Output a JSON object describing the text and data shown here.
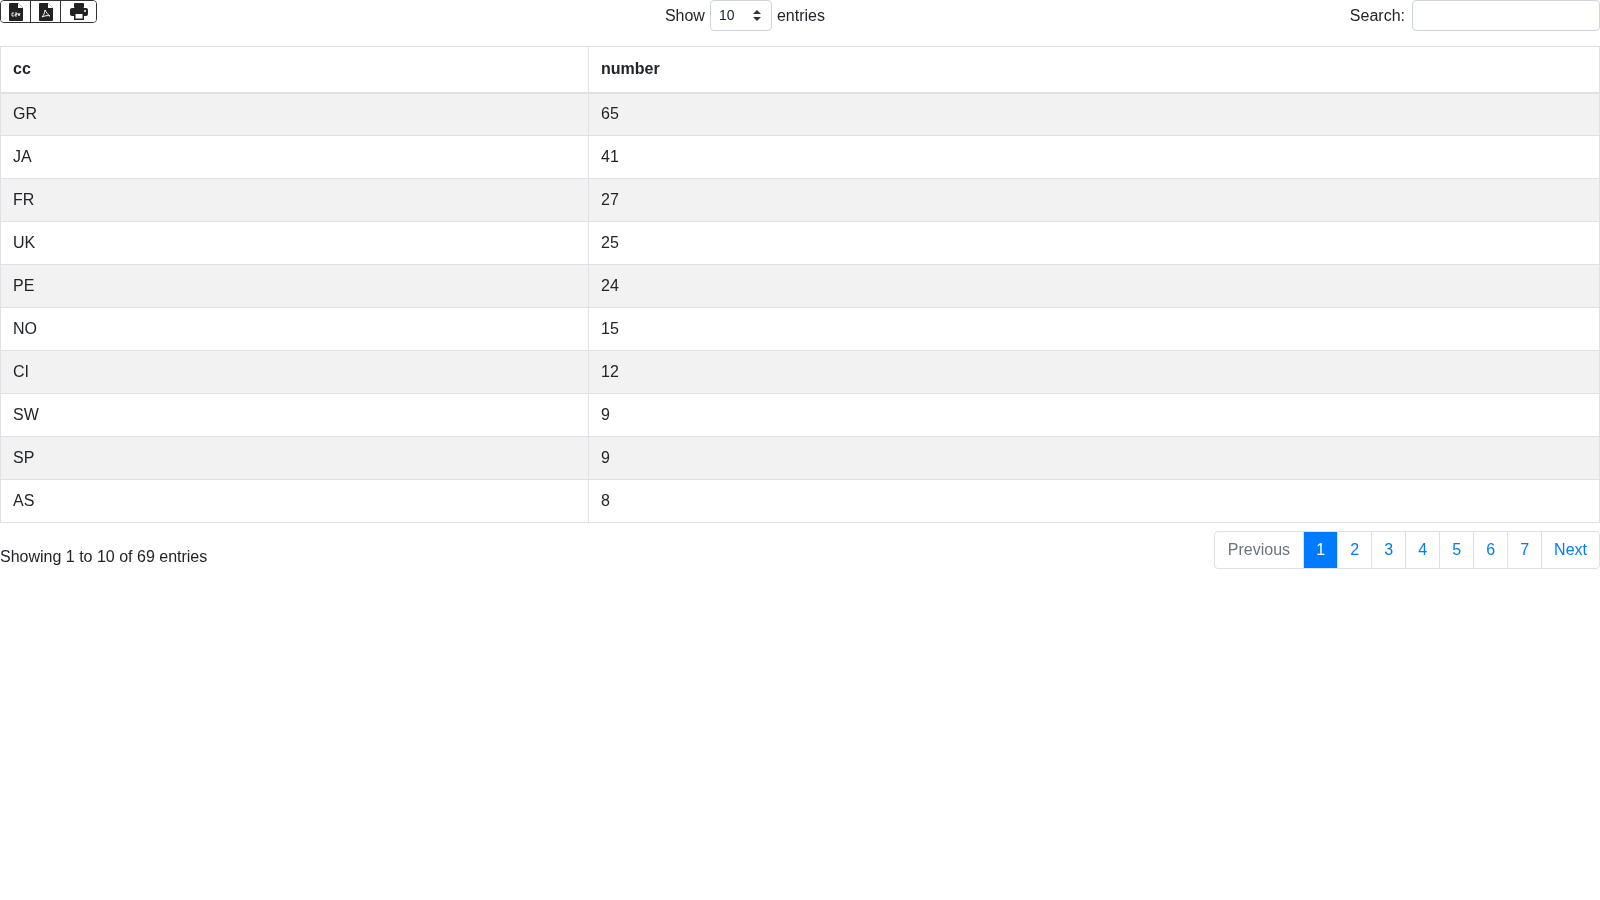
{
  "toolbar": {
    "buttons": [
      {
        "kind": "csv"
      },
      {
        "kind": "pdf"
      },
      {
        "kind": "print"
      }
    ]
  },
  "length": {
    "label_before": "Show",
    "value": "10",
    "label_after": "entries"
  },
  "search": {
    "label": "Search:"
  },
  "table": {
    "columns": [
      "cc",
      "number"
    ],
    "rows": [
      [
        "GR",
        "65"
      ],
      [
        "JA",
        "41"
      ],
      [
        "FR",
        "27"
      ],
      [
        "UK",
        "25"
      ],
      [
        "PE",
        "24"
      ],
      [
        "NO",
        "15"
      ],
      [
        "CI",
        "12"
      ],
      [
        "SW",
        "9"
      ],
      [
        "SP",
        "9"
      ],
      [
        "AS",
        "8"
      ]
    ]
  },
  "info": "Showing 1 to 10 of 69 entries",
  "pagination": {
    "previous": {
      "label": "Previous",
      "disabled": true
    },
    "pages": [
      {
        "label": "1",
        "selected": true
      },
      {
        "label": "2",
        "selected": false
      },
      {
        "label": "3",
        "selected": false
      },
      {
        "label": "4",
        "selected": false
      },
      {
        "label": "5",
        "selected": false
      },
      {
        "label": "6",
        "selected": false
      },
      {
        "label": "7",
        "selected": false
      }
    ],
    "next": {
      "label": "Next",
      "disabled": false
    }
  }
}
